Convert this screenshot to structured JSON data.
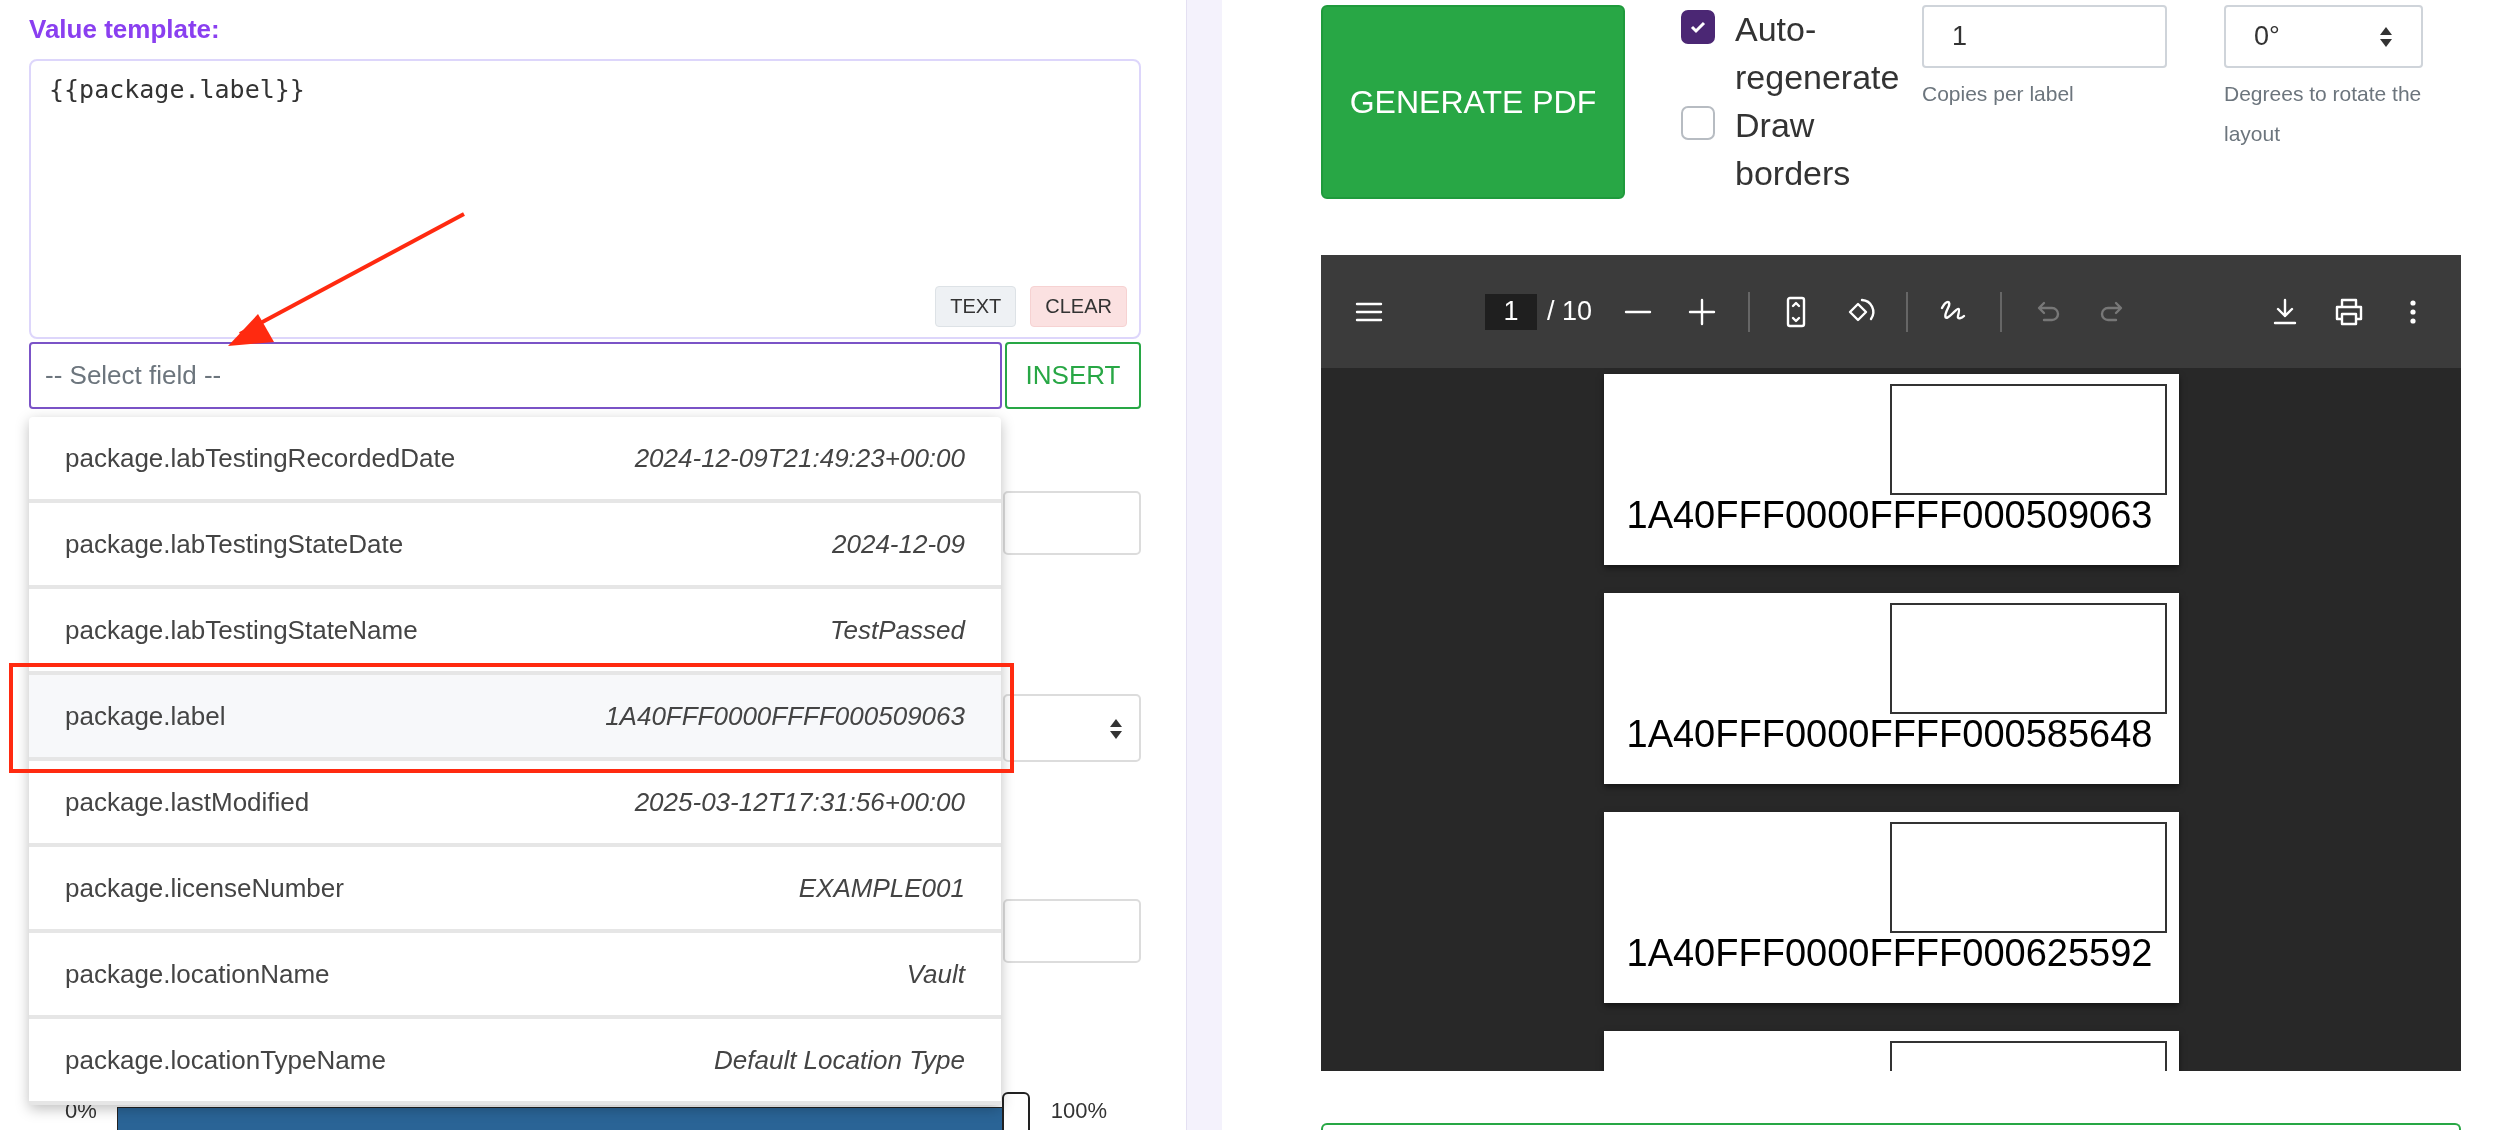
{
  "template": {
    "label": "Value template:",
    "value": "{{package.label}}",
    "buttons": [
      {
        "kind": "neutral",
        "label": "TEXT"
      },
      {
        "kind": "danger",
        "label": "CLEAR"
      }
    ]
  },
  "field_select": {
    "placeholder": "-- Select field --",
    "button": "INSERT"
  },
  "dropdown": [
    {
      "key": "package.labTestingRecordedDate",
      "value": "2024-12-09T21:49:23+00:00",
      "selected": false,
      "callout": false
    },
    {
      "key": "package.labTestingStateDate",
      "value": "2024-12-09",
      "selected": false,
      "callout": false
    },
    {
      "key": "package.labTestingStateName",
      "value": "TestPassed",
      "selected": false,
      "callout": false
    },
    {
      "key": "package.label",
      "value": "1A40FFF0000FFFF000509063",
      "selected": true,
      "callout": true
    },
    {
      "key": "package.lastModified",
      "value": "2025-03-12T17:31:56+00:00",
      "selected": false,
      "callout": false
    },
    {
      "key": "package.licenseNumber",
      "value": "EXAMPLE001",
      "selected": false,
      "callout": false
    },
    {
      "key": "package.locationName",
      "value": "Vault",
      "selected": false,
      "callout": false
    },
    {
      "key": "package.locationTypeName",
      "value": "Default Location Type",
      "selected": false,
      "callout": false
    }
  ],
  "slider": {
    "min_label": "0%",
    "max_label": "100%",
    "level": 1
  },
  "generate_button": "GENERATE PDF",
  "options": [
    {
      "label": "Auto-regenerate",
      "checked": true
    },
    {
      "label": "Draw borders",
      "checked": false
    }
  ],
  "copies": {
    "value": "1",
    "help": "Copies per label"
  },
  "rotation": {
    "value": "0°",
    "help": "Degrees to rotate the layout"
  },
  "viewer": {
    "page": "1",
    "page_total": "/ 10",
    "tools": [
      {
        "kind": "zoom-out",
        "disabled": false
      },
      {
        "kind": "zoom-in",
        "disabled": false
      },
      {
        "kind": "sep"
      },
      {
        "kind": "fit",
        "disabled": false
      },
      {
        "kind": "rotate",
        "disabled": false
      },
      {
        "kind": "sep"
      },
      {
        "kind": "draw",
        "disabled": false
      },
      {
        "kind": "sep"
      },
      {
        "kind": "undo",
        "disabled": true
      },
      {
        "kind": "redo",
        "disabled": true
      }
    ],
    "pages": [
      {
        "kind": "label",
        "label": "1A40FFF0000FFFF000509063"
      },
      {
        "kind": "label",
        "label": "1A40FFF0000FFFF000585648"
      },
      {
        "kind": "label",
        "label": "1A40FFF0000FFFF000625592"
      },
      {
        "kind": "label"
      }
    ]
  }
}
